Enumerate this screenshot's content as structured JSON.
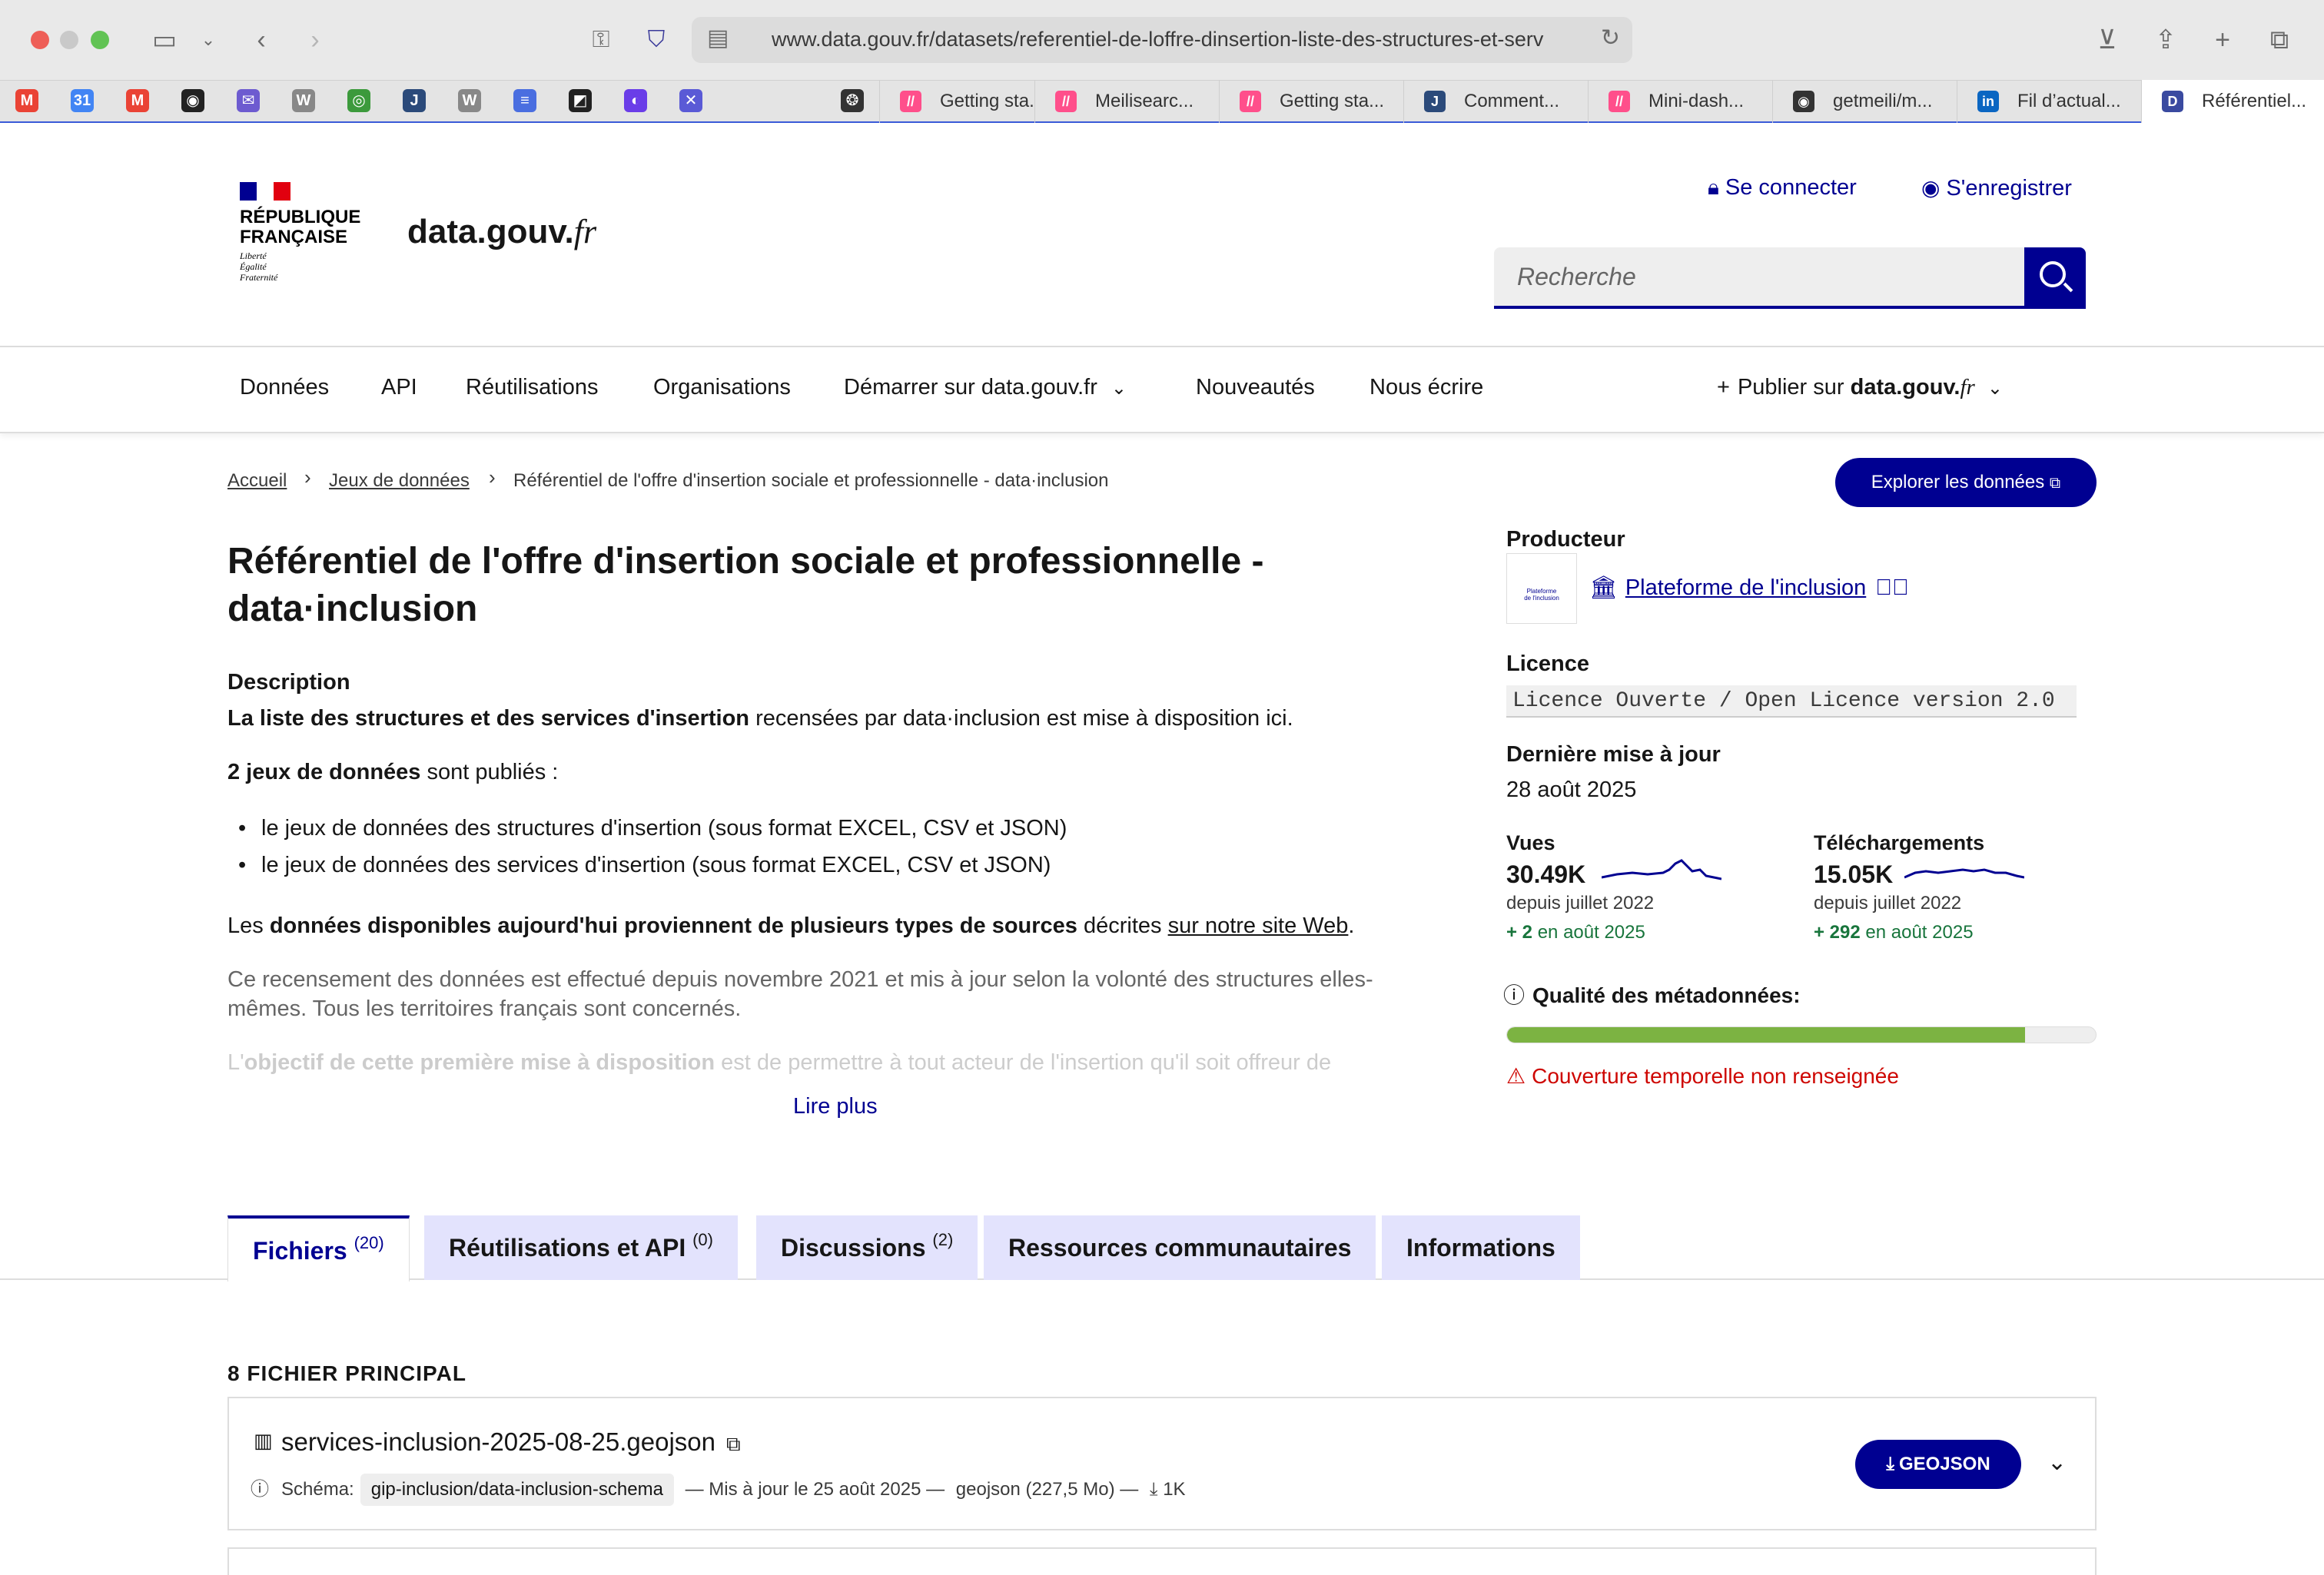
{
  "browser": {
    "url": "www.data.gouv.fr/datasets/referentiel-de-loffre-dinsertion-liste-des-structures-et-serv",
    "tabs": [
      {
        "label": "Getting sta...",
        "icon": "tab-icon-getting-started"
      },
      {
        "label": "Meilisearc...",
        "icon": "tab-icon-meilisearch"
      },
      {
        "label": "Getting sta...",
        "icon": "tab-icon-getting-started-2"
      },
      {
        "label": "Comment...",
        "icon": "tab-icon-comment"
      },
      {
        "label": "Mini-dash...",
        "icon": "tab-icon-mini-dash"
      },
      {
        "label": "getmeili/m...",
        "icon": "tab-icon-github"
      },
      {
        "label": "Fil d’actual...",
        "icon": "tab-icon-linkedin"
      },
      {
        "label": "Référentiel...",
        "icon": "tab-icon-datagouv"
      }
    ]
  },
  "header": {
    "republique": "RÉPUBLIQUE\nFRANÇAISE",
    "motto": "Liberté\nÉgalité\nFraternité",
    "site_name_main": "data.gouv.",
    "site_name_tld": "fr",
    "login": "Se connecter",
    "register": "S'enregistrer",
    "search_placeholder": "Recherche"
  },
  "nav": {
    "items": [
      "Données",
      "API",
      "Réutilisations",
      "Organisations",
      "Démarrer sur data.gouv.fr",
      "Nouveautés",
      "Nous écrire"
    ],
    "publish_prefix": "Publier sur ",
    "publish_site": "data.gouv.",
    "publish_tld": "fr"
  },
  "breadcrumb": {
    "home": "Accueil",
    "datasets": "Jeux de données",
    "current": "Référentiel de l'offre d'insertion sociale et professionnelle - data·inclusion"
  },
  "explore_button": "Explorer les données",
  "dataset": {
    "title": "Référentiel de l'offre d'insertion sociale et professionnelle - data·inclusion",
    "description_heading": "Description",
    "p1_bold": "La liste des structures et des services d'insertion",
    "p1_rest": " recensées par data·inclusion est mise à disposition ici.",
    "p2_bold": "2 jeux de données",
    "p2_rest": " sont publiés :",
    "bullets": [
      "le jeux de données des structures d'insertion (sous format EXCEL, CSV et JSON)",
      "le jeux de données des services d'insertion (sous format EXCEL, CSV et JSON)"
    ],
    "p3_start": "Les ",
    "p3_bold": "données disponibles aujourd'hui proviennent de plusieurs types de sources",
    "p3_mid": " décrites ",
    "p3_link": "sur notre site Web",
    "p3_end": ".",
    "p4": "Ce recensement des données est effectué depuis novembre 2021 et mis à jour selon la volonté des structures elles-mêmes. Tous les territoires français sont concernés.",
    "p5_start": "L'",
    "p5_bold": "objectif de cette première mise à disposition",
    "p5_rest": " est de permettre à tout acteur de l'insertion qu'il soit offreur de",
    "read_more": "Lire plus"
  },
  "sidebar": {
    "producer_label": "Producteur",
    "producer_logo_text": "Plateforme\nde l'inclusion",
    "producer_name": "Plateforme de l'inclusion",
    "licence_label": "Licence",
    "licence_value": "Licence Ouverte / Open Licence version 2.0",
    "updated_label": "Dernière mise à jour",
    "updated_value": "28 août 2025",
    "views_label": "Vues",
    "views_value": "30.49K",
    "views_since": "depuis juillet 2022",
    "views_delta_num": "+ 2",
    "views_delta_rest": " en août 2025",
    "downloads_label": "Téléchargements",
    "downloads_value": "15.05K",
    "downloads_since": "depuis juillet 2022",
    "downloads_delta_num": "+ 292",
    "downloads_delta_rest": " en août 2025",
    "quality_label": "Qualité des métadonnées:",
    "quality_fraction": 0.88,
    "quality_warning": "Couverture temporelle non renseignée"
  },
  "tabs": [
    {
      "label": "Fichiers",
      "count": "(20)",
      "active": true
    },
    {
      "label": "Réutilisations et API",
      "count": "(0)",
      "active": false
    },
    {
      "label": "Discussions",
      "count": "(2)",
      "active": false
    },
    {
      "label": "Ressources communautaires",
      "count": "",
      "active": false
    },
    {
      "label": "Informations",
      "count": "",
      "active": false
    }
  ],
  "files": {
    "section_title": "8 FICHIER PRINCIPAL",
    "items": [
      {
        "name": "services-inclusion-2025-08-25.geojson",
        "schema_label": "Schéma:",
        "schema_value": "gip-inclusion/data-inclusion-schema",
        "updated": "— Mis à jour le 25 août 2025 —",
        "format_size": "geojson (227,5 Mo) —",
        "downloads": "1K",
        "button": "GEOJSON"
      }
    ]
  },
  "colors": {
    "brand_blue": "#000091",
    "tab_bg": "#e3e3fd",
    "success_green": "#18753c",
    "warning_red": "#ce0500",
    "quality_fill": "#7cb342"
  }
}
